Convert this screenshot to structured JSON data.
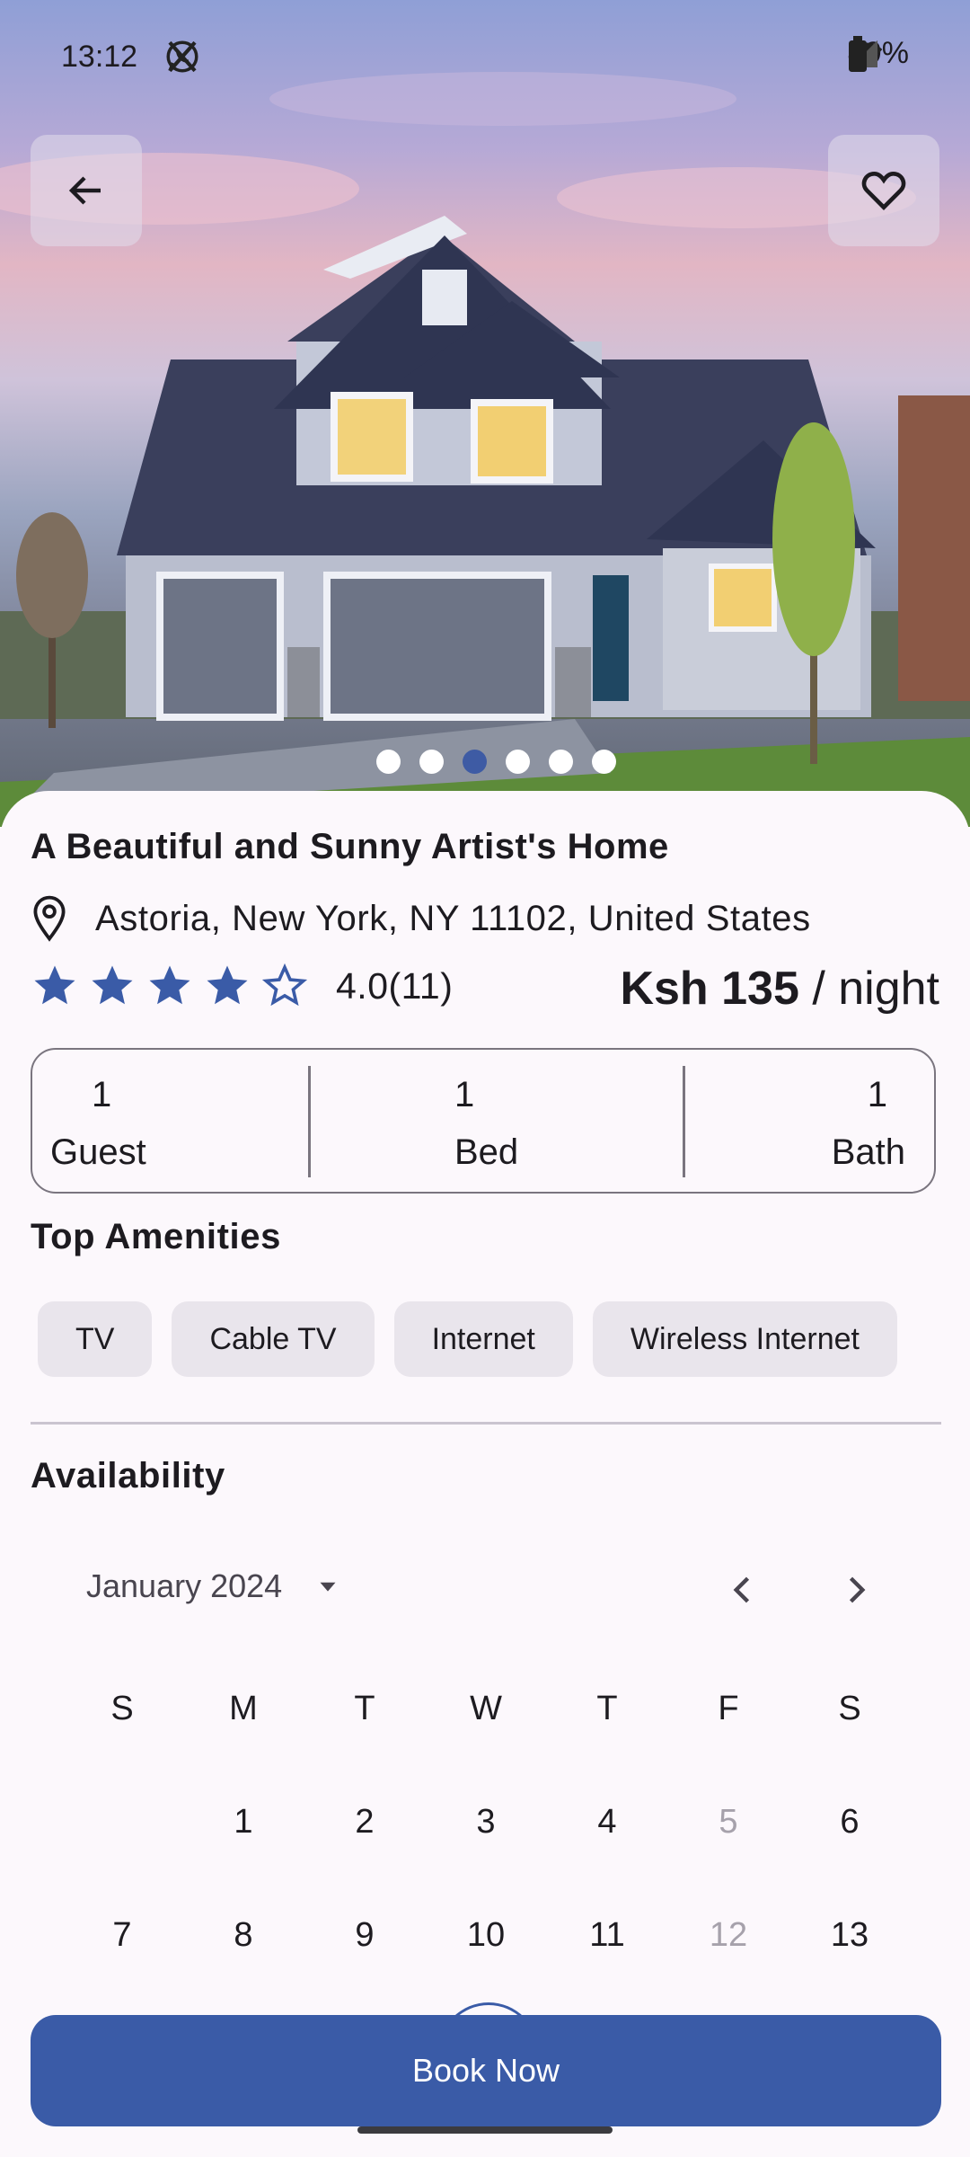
{
  "status_bar": {
    "time": "13:12",
    "app_icons": [
      "whatsapp-icon",
      "x-icon"
    ],
    "right_icons": [
      "wifi-icon",
      "signal-icon",
      "signal-icon",
      "battery-icon"
    ],
    "battery": "49%"
  },
  "hero": {
    "image": "two-story house with garage at dusk",
    "carousel_total": 6,
    "carousel_active_index": 2
  },
  "listing": {
    "title": "A Beautiful and Sunny Artist's Home",
    "location": "Astoria, New York, NY 11102, United States",
    "rating_value": 4,
    "rating_max": 5,
    "rating_text": "4.0(11)",
    "price_amount": "Ksh 135",
    "price_unit": " / night"
  },
  "stats": [
    {
      "num": "1",
      "label": "Guest"
    },
    {
      "num": "1",
      "label": "Bed"
    },
    {
      "num": "1",
      "label": "Bath"
    }
  ],
  "amenities": {
    "title": "Top Amenities",
    "items": [
      "TV",
      "Cable TV",
      "Internet",
      "Wireless Internet"
    ]
  },
  "availability": {
    "title": "Availability",
    "month": "January 2024",
    "weekdays": [
      "S",
      "M",
      "T",
      "W",
      "T",
      "F",
      "S"
    ],
    "week1": [
      "",
      "1",
      "2",
      "3",
      "4",
      "5",
      "6"
    ],
    "week2": [
      "7",
      "8",
      "9",
      "10",
      "11",
      "12",
      "13"
    ],
    "disabled_days": [
      "5",
      "12"
    ]
  },
  "actions": {
    "book_label": "Book Now"
  },
  "colors": {
    "accent": "#3a5ba7",
    "background": "#fcf8fc",
    "chip": "#e9e5ec"
  }
}
